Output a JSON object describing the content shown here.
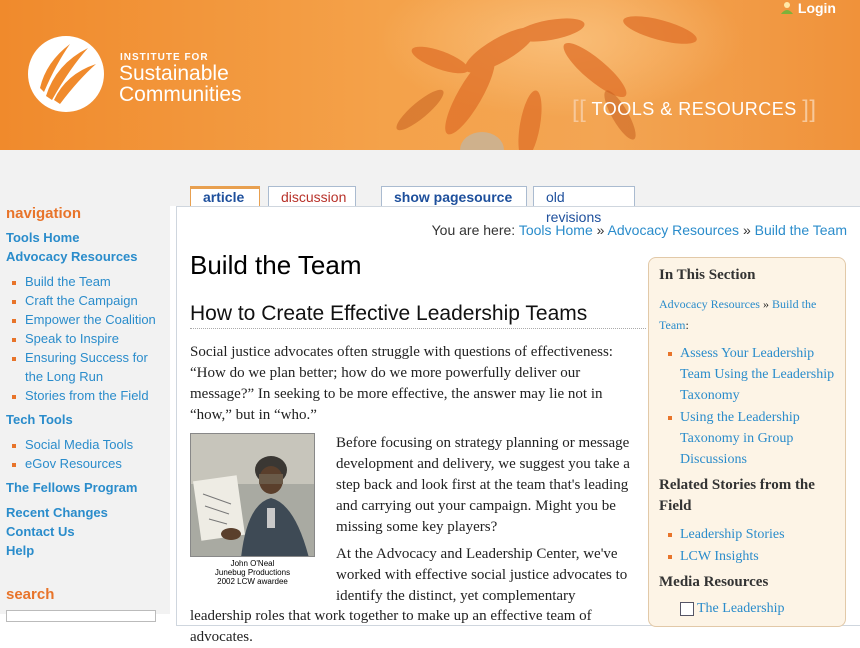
{
  "header": {
    "org_line1": "INSTITUTE FOR",
    "org_line2": "Sustainable",
    "org_line3": "Communities",
    "section_title": "TOOLS & RESOURCES",
    "bracket_open": "[[",
    "bracket_close": "]]",
    "login_label": "Login"
  },
  "nav": {
    "heading": "navigation",
    "tools_home": "Tools Home",
    "advocacy": "Advocacy Resources",
    "advocacy_items": [
      "Build the Team",
      "Craft the Campaign",
      "Empower the Coalition",
      "Speak to Inspire",
      "Ensuring Success for the Long Run",
      "Stories from the Field"
    ],
    "tech_tools": "Tech Tools",
    "tech_items": [
      "Social Media Tools",
      "eGov Resources"
    ],
    "fellows": "The Fellows Program",
    "recent": "Recent Changes",
    "contact": "Contact Us",
    "help": "Help",
    "search_heading": "search"
  },
  "tabs": {
    "article": "article",
    "discussion": "discussion",
    "source": "show pagesource",
    "revisions": "old revisions"
  },
  "breadcrumb": {
    "prefix": "You are here:",
    "items": [
      "Tools Home",
      "Advocacy Resources",
      "Build the Team"
    ],
    "sep": "»"
  },
  "article": {
    "title": "Build the Team",
    "subtitle": "How to Create Effective Leadership Teams",
    "p1": "Social justice advocates often struggle with questions of effectiveness: “How do we plan better; how do we more powerfully deliver our message?” In seeking to be more effective, the answer may lie not in “how,” but in “who.”",
    "caption_1": "John O'Neal",
    "caption_2": "Junebug Productions",
    "caption_3": "2002 LCW awardee",
    "p2": "Before focusing on strategy planning or message development and delivery, we suggest you take a step back and look first at the team that's leading and carrying out your campaign. Might you be missing some key players?",
    "p3": "At the Advocacy and Leadership Center, we've worked with effective social justice advocates to identify the distinct, yet complementary",
    "p4": "leadership roles that work together to make up an effective team of advocates."
  },
  "sidebar": {
    "heading": "In This Section",
    "crumb_a": "Advocacy Resources",
    "crumb_sep": "»",
    "crumb_b": "Build the Team",
    "crumb_end": ":",
    "items": [
      "Assess Your Leadership Team Using the Leadership Taxonomy",
      "Using the Leadership Taxonomy in Group Discussions"
    ],
    "related_heading": "Related Stories from the Field",
    "related_items": [
      "Leadership Stories",
      "LCW Insights"
    ],
    "media_heading": "Media Resources",
    "media_item": "The Leadership"
  },
  "colors": {
    "accent_orange": "#e8742a",
    "link_blue": "#2a8ccb",
    "tab_blue": "#1d4f9c",
    "tab_red": "#b8322a"
  }
}
